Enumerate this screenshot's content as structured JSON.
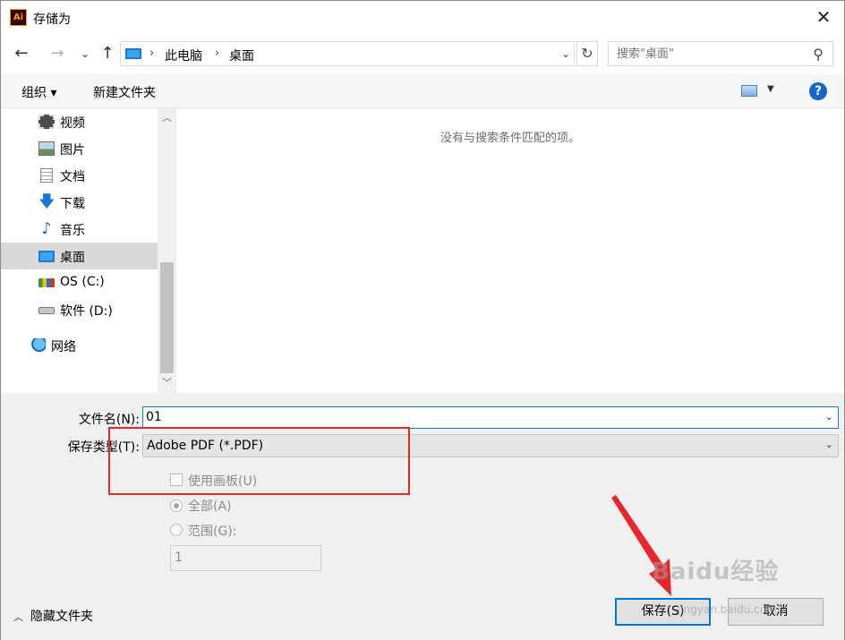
{
  "window": {
    "app_icon": "Ai",
    "title": "存储为",
    "close_icon": "close-icon"
  },
  "navigation": {
    "breadcrumb": [
      "此电脑",
      "桌面"
    ],
    "search_placeholder": "搜索\"桌面\""
  },
  "toolbar": {
    "organize_label": "组织 ▾",
    "new_folder_label": "新建文件夹",
    "help_label": "?"
  },
  "sidebar": {
    "items": [
      {
        "label": "视频",
        "icon": "video-folder-icon"
      },
      {
        "label": "图片",
        "icon": "pictures-folder-icon"
      },
      {
        "label": "文档",
        "icon": "documents-folder-icon"
      },
      {
        "label": "下载",
        "icon": "downloads-folder-icon"
      },
      {
        "label": "音乐",
        "icon": "music-folder-icon"
      },
      {
        "label": "桌面",
        "icon": "desktop-folder-icon",
        "selected": true
      },
      {
        "label": "OS (C:)",
        "icon": "windows-drive-icon"
      },
      {
        "label": "软件 (D:)",
        "icon": "drive-icon"
      },
      {
        "label": "网络",
        "icon": "network-icon"
      }
    ]
  },
  "content": {
    "empty_message": "没有与搜索条件匹配的项。"
  },
  "form": {
    "filename_label": "文件名(N):",
    "filename_value": "01",
    "filetype_label": "保存类型(T):",
    "filetype_value": "Adobe PDF (*.PDF)",
    "use_artboards_label": "使用画板(U)",
    "use_artboards_checked": false,
    "all_label": "全部(A)",
    "range_label": "范围(G):",
    "range_value": "1"
  },
  "footer": {
    "hide_folders_label": "隐藏文件夹",
    "save_label": "保存(S)",
    "cancel_label": "取消"
  },
  "watermark": {
    "text": "Baidu经验",
    "url": "jingyan.baidu.com"
  },
  "colors": {
    "accent": "#0078d7",
    "annotation": "#e8262b",
    "selected_bg": "#d9d9d9"
  }
}
